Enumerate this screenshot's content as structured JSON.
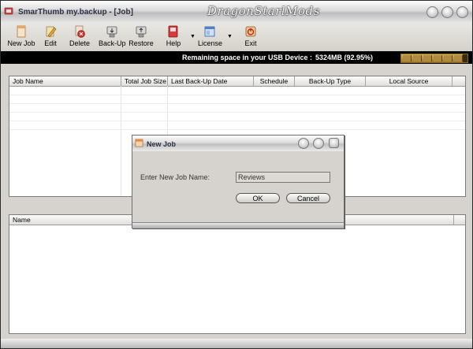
{
  "window": {
    "title": "SmarThumb my.backup - [Job]",
    "watermark": "DragonStarlMods"
  },
  "toolbar": {
    "items": [
      {
        "label": "New Job",
        "icon": "new-job-icon"
      },
      {
        "label": "Edit",
        "icon": "edit-pencil-icon"
      },
      {
        "label": "Delete",
        "icon": "delete-icon"
      },
      {
        "label": "Back-Up",
        "icon": "backup-icon"
      },
      {
        "label": "Restore",
        "icon": "restore-icon"
      },
      {
        "label": "Help",
        "icon": "help-icon"
      },
      {
        "label": "License",
        "icon": "license-icon"
      },
      {
        "label": "Exit",
        "icon": "exit-icon"
      }
    ]
  },
  "status": {
    "label": "Remaining space in your USB Device :",
    "value": "5324MB (92.95%)",
    "percent": 92.95
  },
  "jobs_table": {
    "columns": [
      "Job Name",
      "Total Job Size",
      "Last Back-Up Date",
      "Schedule",
      "Back-Up Type",
      "Local Source"
    ]
  },
  "files_table": {
    "columns": [
      "Name"
    ]
  },
  "dialog": {
    "title": "New Job",
    "prompt": "Enter New Job Name:",
    "input_value": "Reviews",
    "ok_label": "OK",
    "cancel_label": "Cancel"
  },
  "colors": {
    "status_bg": "#000000",
    "meter_fill": "#b08a3e",
    "title_text": "#2b2f44"
  }
}
